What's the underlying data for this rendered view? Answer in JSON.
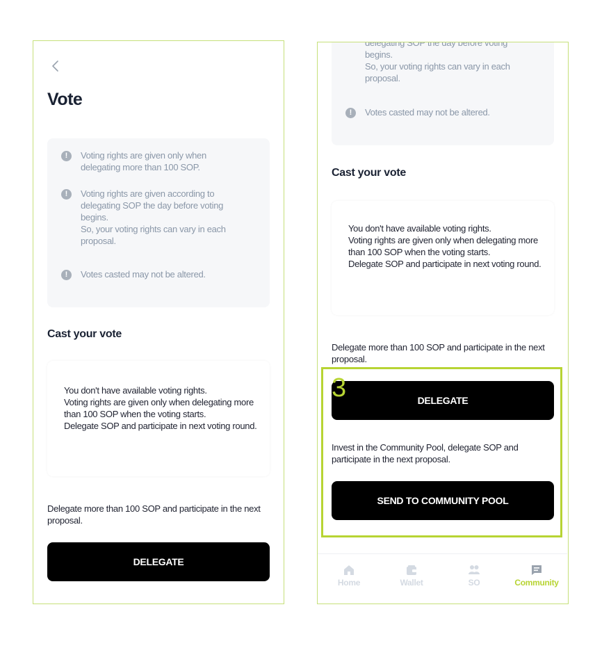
{
  "left_screen": {
    "title": "Vote",
    "notices": [
      {
        "text": "Voting rights are given only when delegating more than 100 SOP."
      },
      {
        "text": "Voting rights are given according to delegating SOP the day before voting begins.\nSo, your voting rights can vary in each proposal."
      },
      {
        "text": "Votes casted may not be altered."
      }
    ],
    "cast_title": "Cast your vote",
    "no_rights_message": "You don't have available voting rights.\nVoting rights are given only when delegating more than 100 SOP when the voting starts.\nDelegate SOP and participate in next voting round.",
    "delegate_description": "Delegate more than 100 SOP and participate in the next proposal.",
    "delegate_button": "DELEGATE"
  },
  "right_screen": {
    "notice_partial_text": "delegating SOP the day before voting begins.\nSo, your voting rights can vary in each proposal.",
    "notice_last_text": "Votes casted may not be altered.",
    "cast_title": "Cast your vote",
    "no_rights_message": "You don't have available voting rights.\nVoting rights are given only when delegating more than 100 SOP when the voting starts.\nDelegate SOP and participate in next voting round.",
    "delegate_description": "Delegate more than 100 SOP and participate in the next proposal.",
    "delegate_button": "DELEGATE",
    "community_description": "Invest in the Community Pool, delegate SOP and participate in the next proposal.",
    "community_button": "SEND TO COMMUNITY POOL",
    "highlight_number": "3",
    "nav": [
      {
        "label": "Home",
        "icon": "home-icon",
        "active": false
      },
      {
        "label": "Wallet",
        "icon": "wallet-icon",
        "active": false
      },
      {
        "label": "SO",
        "icon": "people-icon",
        "active": false
      },
      {
        "label": "Community",
        "icon": "chat-icon",
        "active": true
      }
    ]
  },
  "colors": {
    "accent": "#b7d433",
    "frame_border": "#c6e07a",
    "notice_bg": "#f6f7f9",
    "notice_text": "#8a97a8",
    "button_bg": "#000000",
    "nav_inactive": "#d4dae2"
  }
}
